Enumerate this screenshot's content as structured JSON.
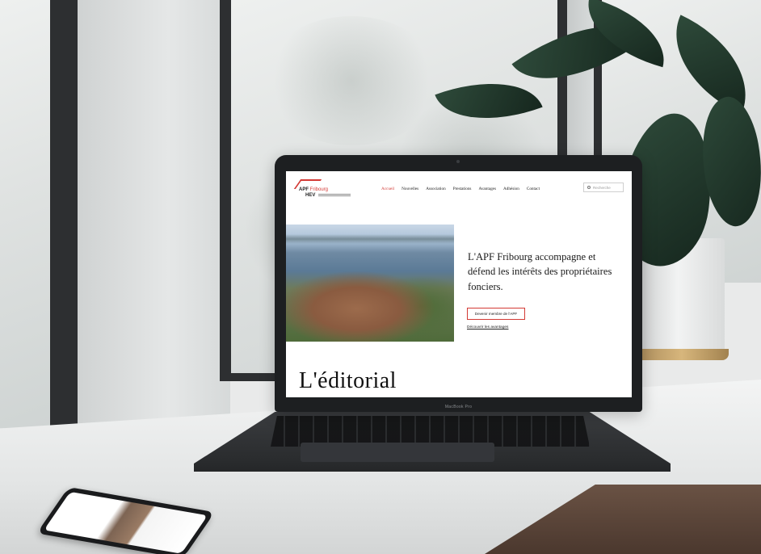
{
  "site": {
    "logo": {
      "line1_bold": "APF",
      "line1_accent": "Fribourg",
      "line2": "HEV"
    },
    "nav": {
      "items": [
        {
          "label": "Accueil",
          "active": true
        },
        {
          "label": "Nouvelles",
          "active": false
        },
        {
          "label": "Association",
          "active": false
        },
        {
          "label": "Prestations",
          "active": false
        },
        {
          "label": "Avantages",
          "active": false
        },
        {
          "label": "Adhésion",
          "active": false
        },
        {
          "label": "Contact",
          "active": false
        }
      ],
      "search_placeholder": "Recherche"
    },
    "hero": {
      "title": "L'APF Fribourg accompagne et défend les intérêts des propriétaires fonciers.",
      "cta_button": "Devenir membre de l'APF",
      "cta_link": "Découvrir les avantages"
    },
    "editorial_heading": "L'éditorial"
  },
  "laptop_label": "MacBook Pro",
  "colors": {
    "accent": "#d33a35",
    "text": "#1b1b1b",
    "laptop": "#1d1f21"
  }
}
